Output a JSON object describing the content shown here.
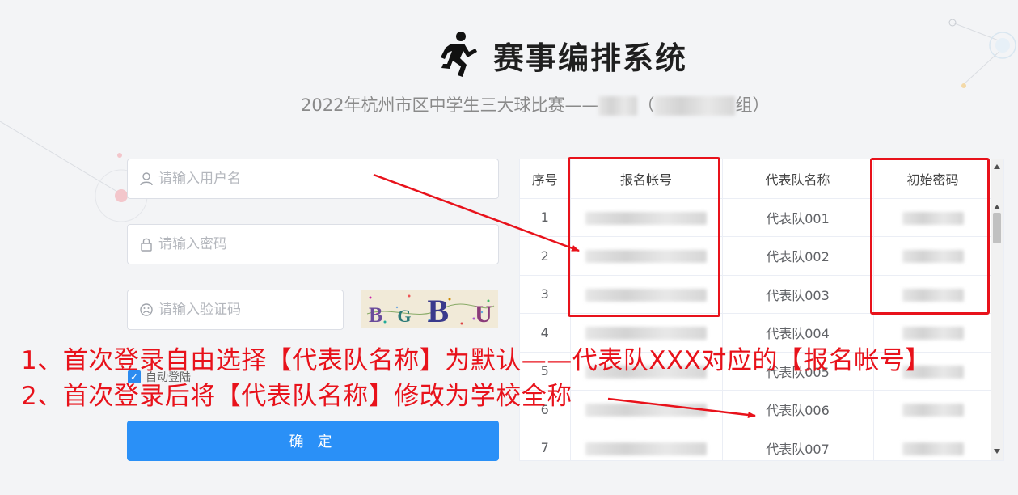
{
  "header": {
    "app_title": "赛事编排系统",
    "subtitle_prefix": "2022年杭州市区中学生三大球比赛——",
    "subtitle_open": "（",
    "subtitle_suffix": "组）"
  },
  "login": {
    "username_placeholder": "请输入用户名",
    "password_placeholder": "请输入密码",
    "captcha_placeholder": "请输入验证码",
    "captcha_text": "BGBU",
    "remember_label": "自动登陆",
    "remember_checked": true,
    "submit_label": "确 定"
  },
  "table": {
    "headers": [
      "序号",
      "报名帐号",
      "代表队名称",
      "初始密码"
    ],
    "rows": [
      {
        "index": "1",
        "team": "代表队001"
      },
      {
        "index": "2",
        "team": "代表队002"
      },
      {
        "index": "3",
        "team": "代表队003"
      },
      {
        "index": "4",
        "team": "代表队004"
      },
      {
        "index": "5",
        "team": "代表队005"
      },
      {
        "index": "6",
        "team": "代表队006"
      },
      {
        "index": "7",
        "team": "代表队007"
      }
    ]
  },
  "annotations": {
    "line1": "1、首次登录自由选择【代表队名称】为默认——代表队XXX对应的【报名帐号】",
    "line2": "2、首次登录后将【代表队名称】修改为学校全称"
  },
  "colors": {
    "accent": "#2a90f7",
    "annotation_red": "#e8121b",
    "background": "#f3f4f6"
  },
  "icons": [
    "runner-logo-icon",
    "user-icon",
    "lock-icon",
    "captcha-face-icon",
    "checkbox-check-icon"
  ]
}
